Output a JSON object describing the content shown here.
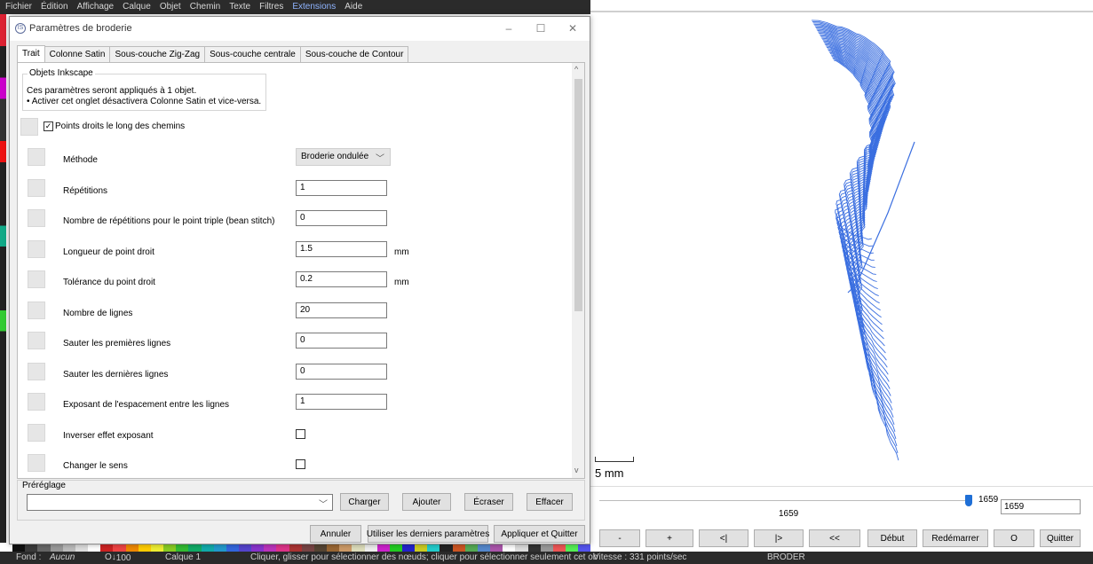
{
  "inkscape": {
    "menu": [
      "Fichier",
      "Édition",
      "Affichage",
      "Calque",
      "Objet",
      "Chemin",
      "Texte",
      "Filtres",
      "Extensions",
      "Aide"
    ],
    "menu_active": "Extensions",
    "status": {
      "fill_label": "Fond :",
      "fill_value": "Aucun",
      "zoom": "100",
      "layer": "Calque 1",
      "message": "Cliquer, glisser pour sélectionner des nœuds; cliquer pour sélectionner seulement cet ob",
      "speed": "Vitesse : 331 points/sec",
      "mode": "BRODER"
    }
  },
  "dialog": {
    "title": "Paramètres de broderie",
    "tabs": [
      "Trait",
      "Colonne Satin",
      "Sous-couche Zig-Zag",
      "Sous-couche centrale",
      "Sous-couche de Contour"
    ],
    "active_tab": "Trait",
    "group_title": "Objets Inkscape",
    "info_line1": "Ces paramètres seront appliqués à 1 objet.",
    "info_line2": "• Activer cet onglet désactivera Colonne Satin et vice-versa.",
    "enable_checkbox_label": "Points droits le long des chemins",
    "enable_checked": true,
    "params": [
      {
        "label": "Méthode",
        "type": "select",
        "value": "Broderie ondulée"
      },
      {
        "label": "Répétitions",
        "type": "input",
        "value": "1",
        "unit": ""
      },
      {
        "label": "Nombre de répétitions pour le point triple (bean stitch)",
        "type": "input",
        "value": "0",
        "unit": ""
      },
      {
        "label": "Longueur de point droit",
        "type": "input",
        "value": "1.5",
        "unit": "mm"
      },
      {
        "label": "Tolérance du point droit",
        "type": "input",
        "value": "0.2",
        "unit": "mm"
      },
      {
        "label": "Nombre de lignes",
        "type": "input",
        "value": "20",
        "unit": ""
      },
      {
        "label": "Sauter les premières lignes",
        "type": "input",
        "value": "0",
        "unit": ""
      },
      {
        "label": "Sauter les dernières lignes",
        "type": "input",
        "value": "0",
        "unit": ""
      },
      {
        "label": "Exposant de l'espacement entre les lignes",
        "type": "input",
        "value": "1",
        "unit": ""
      },
      {
        "label": "Inverser effet exposant",
        "type": "checkbox",
        "checked": false
      },
      {
        "label": "Changer le sens",
        "type": "checkbox",
        "checked": false
      }
    ],
    "preset": {
      "label": "Préréglage",
      "value": "",
      "buttons": [
        "Charger",
        "Ajouter",
        "Écraser",
        "Effacer"
      ]
    },
    "footer_buttons": [
      "Annuler",
      "Utiliser les derniers paramètres",
      "Appliquer et Quitter"
    ]
  },
  "preview": {
    "scale_label": "5 mm",
    "slider_max": "1659",
    "frame_value": "1659",
    "frame_label": "1659",
    "stitch_color": "#3b6fe0",
    "buttons": [
      "-",
      "+",
      "<|",
      "|>",
      "<<",
      "Début",
      "Redémarrer",
      "O",
      "Quitter"
    ]
  }
}
